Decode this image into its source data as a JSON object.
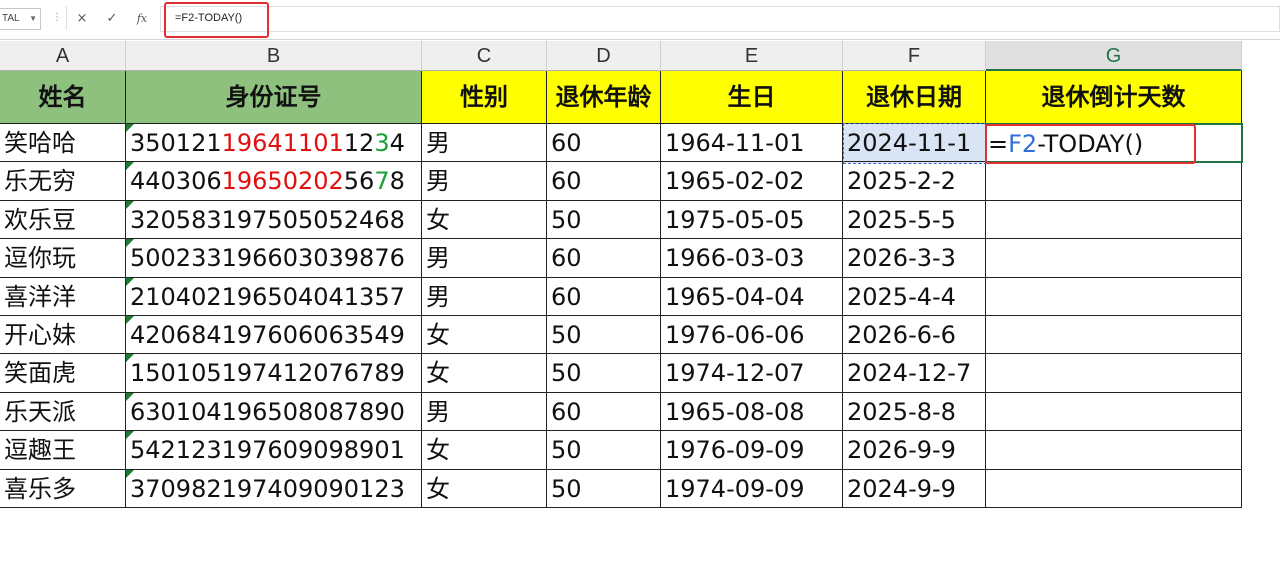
{
  "formula_bar": {
    "name_box": "TAL",
    "cancel_icon": "×",
    "enter_icon": "✓",
    "fx_label": "fx",
    "formula": "=F2-TODAY()"
  },
  "columns": [
    "A",
    "B",
    "C",
    "D",
    "E",
    "F",
    "G"
  ],
  "selected_column": "G",
  "headers": [
    "姓名",
    "身份证号",
    "性别",
    "退休年龄",
    "生日",
    "退休日期",
    "退休倒计天数"
  ],
  "rows": [
    {
      "name": "笑哈哈",
      "id_pre": "350121",
      "id_mid": "19641101",
      "id_post": "12",
      "id_hl": "3",
      "id_end": "4",
      "gender": "男",
      "age": "60",
      "birth": "1964-11-01",
      "retire": "2024-11-1"
    },
    {
      "name": "乐无穷",
      "id_pre": "440306",
      "id_mid": "19650202",
      "id_post": "56",
      "id_hl": "7",
      "id_end": "8",
      "gender": "男",
      "age": "60",
      "birth": "1965-02-02",
      "retire": "2025-2-2"
    },
    {
      "name": "欢乐豆",
      "id": "320583197505052468",
      "gender": "女",
      "age": "50",
      "birth": "1975-05-05",
      "retire": "2025-5-5"
    },
    {
      "name": "逗你玩",
      "id": "500233196603039876",
      "gender": "男",
      "age": "60",
      "birth": "1966-03-03",
      "retire": "2026-3-3"
    },
    {
      "name": "喜洋洋",
      "id": "210402196504041357",
      "gender": "男",
      "age": "60",
      "birth": "1965-04-04",
      "retire": "2025-4-4"
    },
    {
      "name": "开心妹",
      "id": "420684197606063549",
      "gender": "女",
      "age": "50",
      "birth": "1976-06-06",
      "retire": "2026-6-6"
    },
    {
      "name": "笑面虎",
      "id": "150105197412076789",
      "gender": "女",
      "age": "50",
      "birth": "1974-12-07",
      "retire": "2024-12-7"
    },
    {
      "name": "乐天派",
      "id": "630104196508087890",
      "gender": "男",
      "age": "60",
      "birth": "1965-08-08",
      "retire": "2025-8-8"
    },
    {
      "name": "逗趣王",
      "id": "542123197609098901",
      "gender": "女",
      "age": "50",
      "birth": "1976-09-09",
      "retire": "2026-9-9"
    },
    {
      "name": "喜乐多",
      "id": "370982197409090123",
      "gender": "女",
      "age": "50",
      "birth": "1974-09-09",
      "retire": "2024-9-9"
    }
  ],
  "editing_cell": {
    "eq": "=",
    "ref": "F2",
    "rest": "-TODAY()"
  },
  "colors": {
    "header_green": "#8ec07e",
    "header_yellow": "#ffff00",
    "highlight_red": "#e01010",
    "highlight_green": "#18a034",
    "ref_blue": "#2f6fd6",
    "annotation_red": "#e23030"
  }
}
